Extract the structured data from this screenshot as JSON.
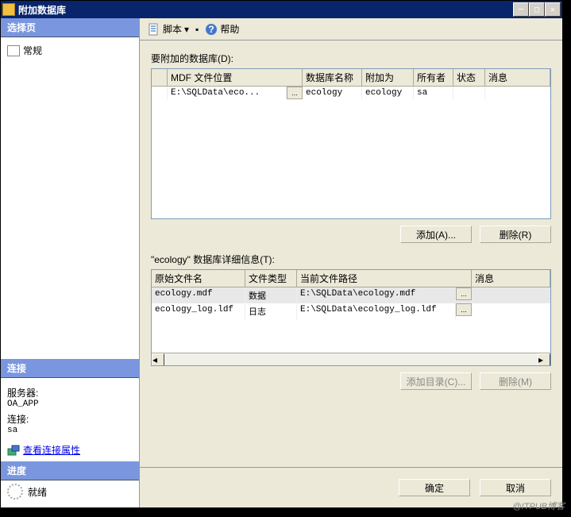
{
  "title": "附加数据库",
  "sidebar": {
    "select_header": "选择页",
    "general": "常规",
    "conn_header": "连接",
    "server_label": "服务器:",
    "server_value": "OA_APP",
    "conn_label": "连接:",
    "conn_value": "sa",
    "view_props": "查看连接属性",
    "progress_header": "进度",
    "progress_status": "就绪"
  },
  "toolbar": {
    "script": "脚本",
    "help": "帮助"
  },
  "main": {
    "attach_label": "要附加的数据库(D):",
    "cols": {
      "mdf": "MDF 文件位置",
      "dbname": "数据库名称",
      "attachas": "附加为",
      "owner": "所有者",
      "status": "状态",
      "msg": "消息"
    },
    "row": {
      "mdf": "E:\\SQLData\\eco...",
      "dbname": "ecology",
      "attachas": "ecology",
      "owner": "sa",
      "status": "",
      "msg": ""
    },
    "add_btn": "添加(A)...",
    "remove_btn": "删除(R)",
    "detail_label": "\"ecology\" 数据库详细信息(T):",
    "dcols": {
      "fname": "原始文件名",
      "ftype": "文件类型",
      "fpath": "当前文件路径",
      "fmsg": "消息"
    },
    "drows": [
      {
        "fname": "ecology.mdf",
        "ftype": "数据",
        "fpath": "E:\\SQLData\\ecology.mdf"
      },
      {
        "fname": "ecology_log.ldf",
        "ftype": "日志",
        "fpath": "E:\\SQLData\\ecology_log.ldf"
      }
    ],
    "add_dir_btn": "添加目录(C)...",
    "remove2_btn": "删除(M)"
  },
  "footer": {
    "ok": "确定",
    "cancel": "取消"
  },
  "watermark": "@ITPUB博客"
}
